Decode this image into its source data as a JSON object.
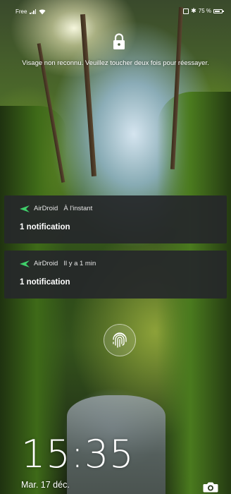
{
  "status_bar": {
    "carrier": "Free",
    "signal_icon": "signal-bars-icon",
    "wifi_icon": "wifi-icon",
    "battery_percent": "75 %",
    "battery_level": 0.75,
    "nfc_icon": "nfc-icon",
    "bluetooth_icon": "bluetooth-icon"
  },
  "lock": {
    "icon": "lock-icon",
    "face_message": "Visage non reconnu. Veuillez toucher deux fois pour réessayer."
  },
  "notifications": [
    {
      "app_icon": "airdroid-icon",
      "app_name": "AirDroid",
      "time": "À l'instant",
      "body": "1 notification"
    },
    {
      "app_icon": "airdroid-icon",
      "app_name": "AirDroid",
      "time": "Il y a 1 min",
      "body": "1 notification"
    }
  ],
  "fingerprint": {
    "icon": "fingerprint-icon"
  },
  "clock": {
    "time": "15:35",
    "date": "Mar. 17 déc."
  },
  "shortcuts": {
    "camera_icon": "camera-icon"
  },
  "colors": {
    "notification_bg": "#26282a",
    "airdroid_accent": "#3fcf6a",
    "text": "#ffffff"
  }
}
